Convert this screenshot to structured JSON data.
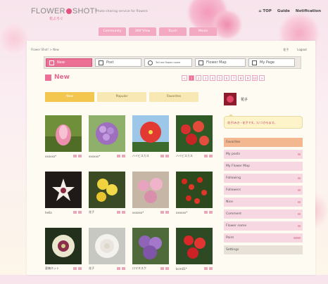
{
  "header": {
    "logo_text": "FLOWER",
    "logo_text_2": "SHOT!",
    "logo_sub": "花ぶろぐ",
    "tagline": "Photo sharing service for flowers",
    "top_links": [
      "TOP",
      "Guide",
      "Notification"
    ]
  },
  "category_tabs": [
    "Community",
    "360°View",
    "Touch",
    "Movie"
  ],
  "breadcrumb": "Flower Shot! > New",
  "account": {
    "user": "花子",
    "logout": "Logout"
  },
  "main_nav": [
    {
      "label": "New",
      "icon": "new-icon",
      "active": true
    },
    {
      "label": "Post",
      "icon": "post-icon"
    },
    {
      "label": "Tell me flower name",
      "icon": "question-icon"
    },
    {
      "label": "Flower Map",
      "icon": "map-icon"
    },
    {
      "label": "My Page",
      "icon": "mypage-icon"
    }
  ],
  "section_title": "New",
  "pager": [
    "<",
    "1",
    "2",
    "3",
    "4",
    "5",
    "6",
    "7",
    "8",
    "9",
    "10",
    ">"
  ],
  "sort_tabs": [
    "New",
    "Popular",
    "Favorites"
  ],
  "photos": [
    {
      "caption": "xxxxxx*",
      "subject": "lotus bud"
    },
    {
      "caption": "xxxxxx*",
      "subject": "purple hydrangea"
    },
    {
      "caption": "ハイビスカス",
      "subject": "red hibiscus"
    },
    {
      "caption": "ハイビスカス",
      "subject": "red flower bush"
    },
    {
      "caption": "hella",
      "subject": "white star flower"
    },
    {
      "caption": "花子",
      "subject": "yellow flowers"
    },
    {
      "caption": "xxxxxx*",
      "subject": "pink flowers"
    },
    {
      "caption": "xxxxxx*",
      "subject": "red berries"
    },
    {
      "caption": "夏椿ネット",
      "subject": "hellebore"
    },
    {
      "caption": "花子",
      "subject": "white rose"
    },
    {
      "caption": "ロマネスク",
      "subject": "lilac purple"
    },
    {
      "caption": "bcm01*",
      "subject": "red begonia"
    }
  ],
  "sidebar": {
    "user_name": "花子",
    "bubble_text": "花子(みき・花子です。)いつかもます。",
    "menu": [
      "Favorites",
      "My posts",
      "My Flower Map",
      "Following",
      "Followers",
      "Nice",
      "Comment",
      "Flower name",
      "Point",
      "Settings"
    ]
  },
  "colors": {
    "accent": "#ec6f95",
    "tab_gold": "#f3c74d",
    "side_pink": "#f7d7e1",
    "side_orange": "#f4b890"
  }
}
